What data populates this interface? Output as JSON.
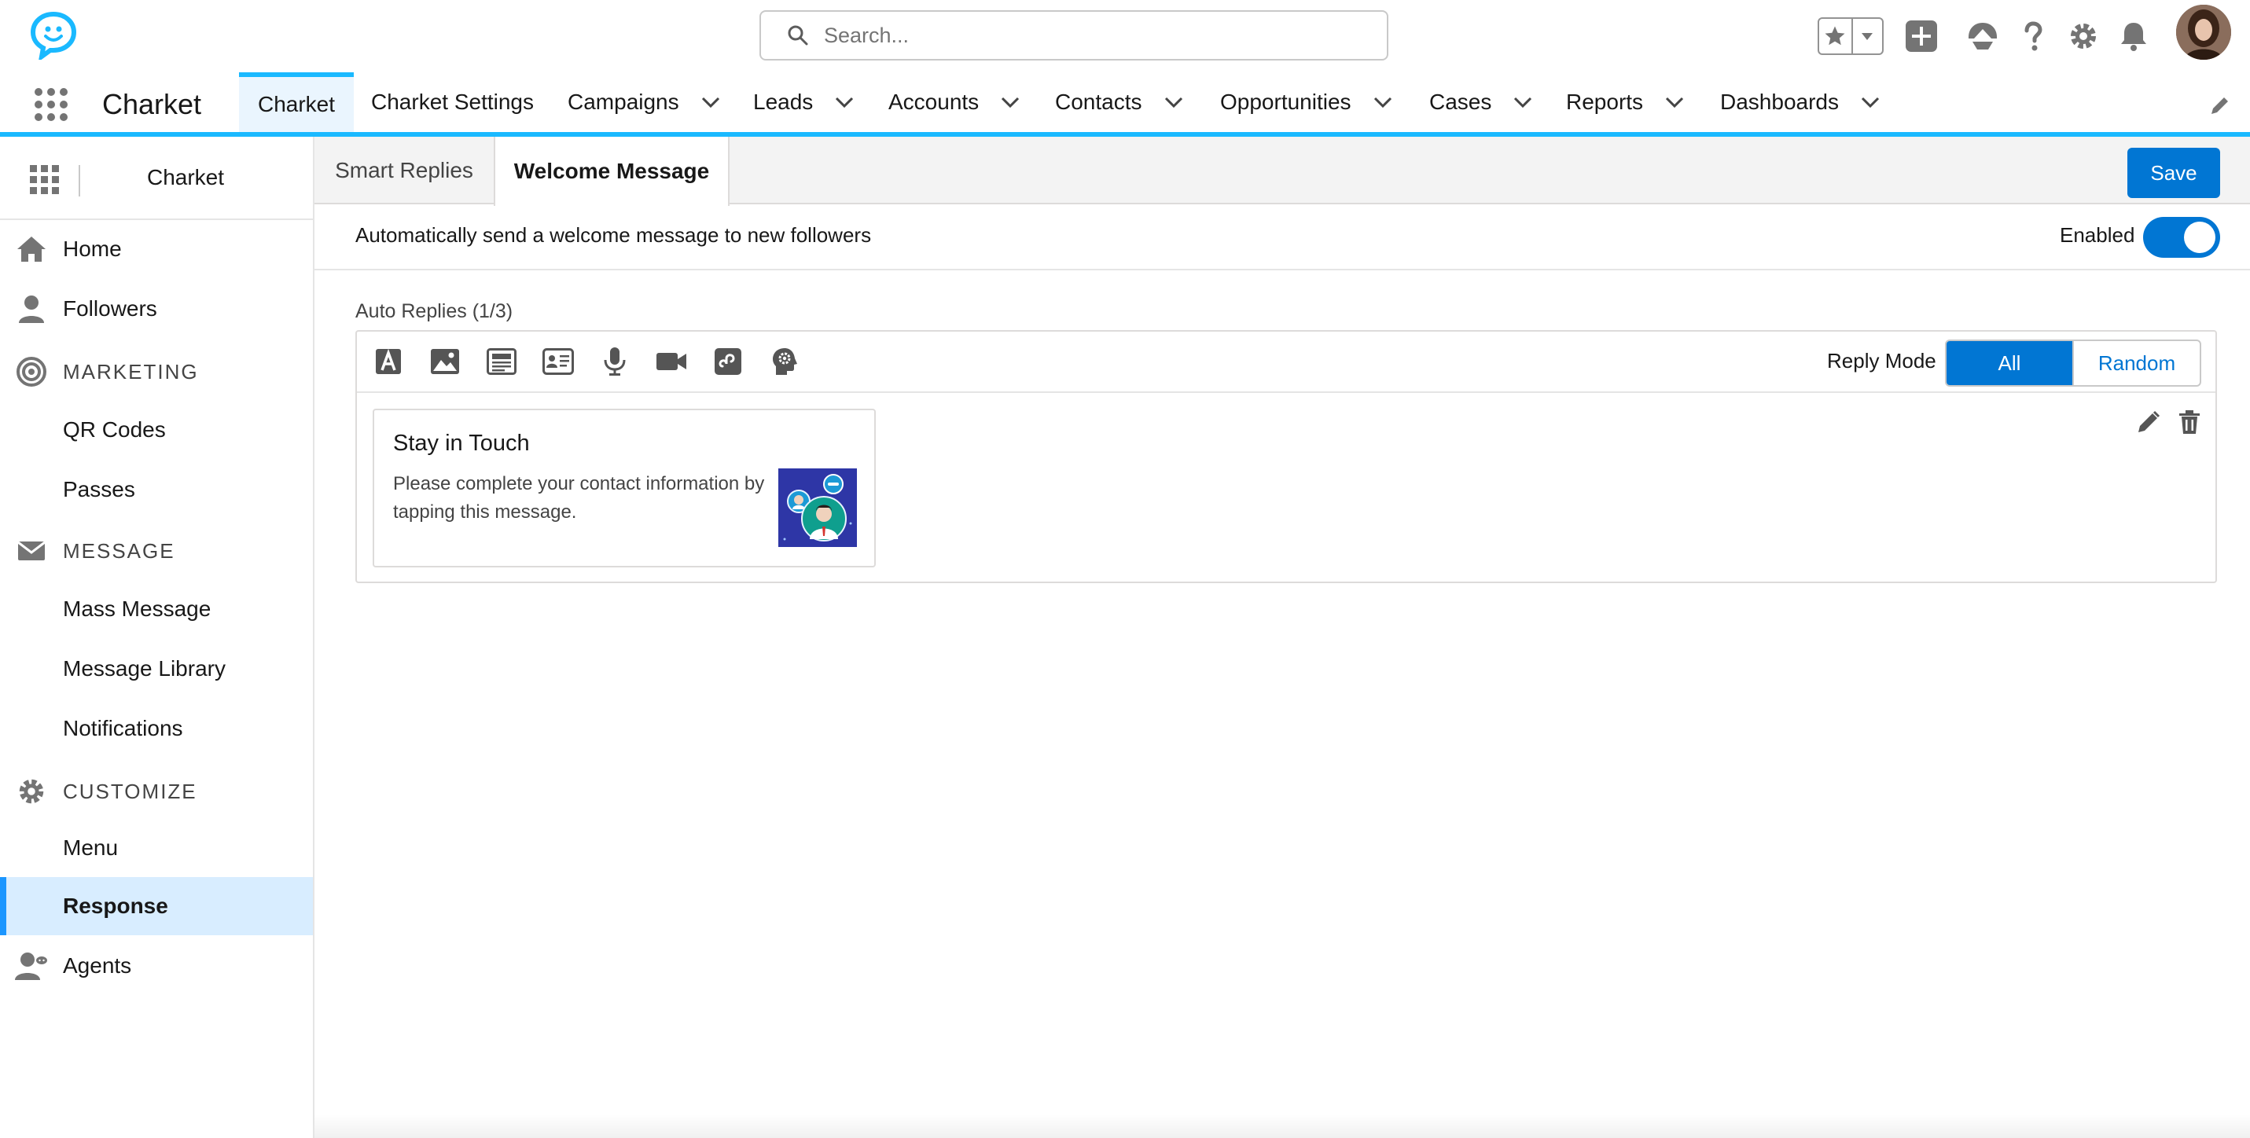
{
  "header": {
    "search_placeholder": "Search...",
    "app_name": "Charket",
    "icons": [
      "charket-logo-icon",
      "search-icon",
      "star-icon",
      "chevron-down-icon",
      "add-icon",
      "trailhead-icon",
      "help-icon",
      "gear-icon",
      "bell-icon",
      "avatar"
    ]
  },
  "nav": {
    "tabs": [
      {
        "label": "Charket",
        "dropdown": false,
        "active": true
      },
      {
        "label": "Charket Settings",
        "dropdown": false
      },
      {
        "label": "Campaigns",
        "dropdown": true
      },
      {
        "label": "Leads",
        "dropdown": true
      },
      {
        "label": "Accounts",
        "dropdown": true
      },
      {
        "label": "Contacts",
        "dropdown": true
      },
      {
        "label": "Opportunities",
        "dropdown": true
      },
      {
        "label": "Cases",
        "dropdown": true
      },
      {
        "label": "Reports",
        "dropdown": true
      },
      {
        "label": "Dashboards",
        "dropdown": true
      }
    ]
  },
  "sidebar": {
    "title": "Charket",
    "items": [
      {
        "label": "Home",
        "icon": "home-icon"
      },
      {
        "label": "Followers",
        "icon": "user-icon"
      },
      {
        "label": "MARKETING",
        "icon": "target-icon",
        "section": true
      },
      {
        "label": "QR Codes"
      },
      {
        "label": "Passes"
      },
      {
        "label": "MESSAGE",
        "icon": "envelope-icon",
        "section": true
      },
      {
        "label": "Mass Message"
      },
      {
        "label": "Message Library"
      },
      {
        "label": "Notifications"
      },
      {
        "label": "CUSTOMIZE",
        "icon": "gear-icon",
        "section": true
      },
      {
        "label": "Menu"
      },
      {
        "label": "Response",
        "active": true
      },
      {
        "label": "Agents",
        "icon": "agent-icon"
      }
    ]
  },
  "main": {
    "tabs": [
      {
        "label": "Smart Replies"
      },
      {
        "label": "Welcome Message",
        "active": true
      }
    ],
    "save_label": "Save",
    "welcome_text": "Automatically send a welcome message to new followers",
    "enabled_label": "Enabled",
    "enabled": true,
    "auto_replies_label": "Auto Replies (1/3)",
    "reply_mode_label": "Reply Mode",
    "reply_mode_options": [
      "All",
      "Random"
    ],
    "reply_mode_selected": "All",
    "card": {
      "title": "Stay in Touch",
      "description": "Please complete your contact information by tapping this message."
    }
  },
  "colors": {
    "brand_blue": "#0176d3",
    "nav_accent": "#1ab9ff",
    "active_item_bg": "#d8edff"
  }
}
